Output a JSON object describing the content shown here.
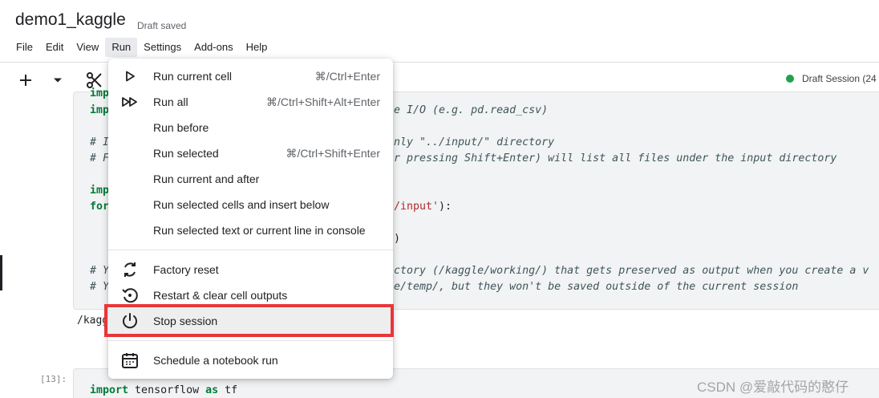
{
  "notebook": {
    "title": "demo1_kaggle",
    "status": "Draft saved"
  },
  "menubar": {
    "items": [
      {
        "label": "File"
      },
      {
        "label": "Edit"
      },
      {
        "label": "View"
      },
      {
        "label": "Run",
        "active": true
      },
      {
        "label": "Settings"
      },
      {
        "label": "Add-ons"
      },
      {
        "label": "Help"
      }
    ]
  },
  "toolbar": {
    "icons": [
      "plus-icon",
      "chevron-down-icon",
      "scissors-icon"
    ],
    "session_status": "Draft Session (24"
  },
  "code_cell_1": {
    "fragments": [
      "imp",
      "imp",
      "le I/O (e.g. pd.read_csv)",
      "# I",
      "nly \"../input/\" directory",
      "# F",
      "r pressing Shift+Enter) will list all files under the input directory",
      "imp",
      "for",
      "/input'",
      "):",
      ")",
      "# Y",
      "ctory (/kaggle/working/) that gets preserved as output when you create a v",
      "# Y",
      "e/temp/, but they won't be saved outside of the current session"
    ],
    "output": "/kagg"
  },
  "code_cell_2": {
    "execution_count": "[13]:",
    "code": {
      "kw1": "import",
      "name": " tensorflow ",
      "kw2": "as",
      "alias": " tf"
    }
  },
  "run_menu": {
    "items": [
      {
        "label": "Run current cell",
        "shortcut": "⌘/Ctrl+Enter",
        "icon": "play-icon"
      },
      {
        "label": "Run all",
        "shortcut": "⌘/Ctrl+Shift+Alt+Enter",
        "icon": "fast-forward-icon"
      },
      {
        "label": "Run before",
        "shortcut": "",
        "icon": ""
      },
      {
        "label": "Run selected",
        "shortcut": "⌘/Ctrl+Shift+Enter",
        "icon": ""
      },
      {
        "label": "Run current and after",
        "shortcut": "",
        "icon": ""
      },
      {
        "label": "Run selected cells and insert below",
        "shortcut": "",
        "icon": ""
      },
      {
        "label": "Run selected text or current line in console",
        "shortcut": "",
        "icon": ""
      },
      {
        "label": "Factory reset",
        "shortcut": "",
        "icon": "refresh-icon"
      },
      {
        "label": "Restart & clear cell outputs",
        "shortcut": "",
        "icon": "restart-icon"
      },
      {
        "label": "Stop session",
        "shortcut": "",
        "icon": "power-icon",
        "highlighted": true
      },
      {
        "label": "Schedule a notebook run",
        "shortcut": "",
        "icon": "calendar-icon"
      }
    ]
  },
  "colors": {
    "highlight_box": "#e8363a",
    "status_dot": "#20a14b",
    "keyword": "#047b3a",
    "string": "#b5272a"
  },
  "watermark": "CSDN @爱敲代码的憨仔"
}
